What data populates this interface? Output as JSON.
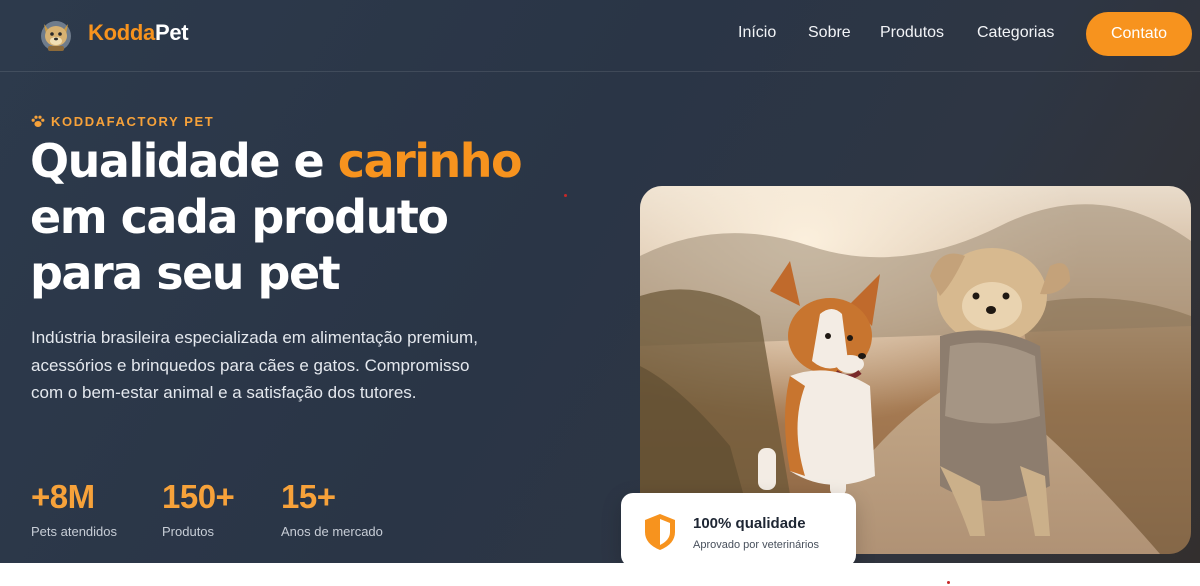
{
  "header": {
    "brand_part1": "Kodda",
    "brand_part2": "Pet",
    "logo_icon": "dog-mascot-logo",
    "nav": [
      "Início",
      "Sobre",
      "Produtos",
      "Categorias"
    ],
    "cta_label": "Contato"
  },
  "hero": {
    "eyebrow_icon": "paw-icon",
    "eyebrow": "KODDAFACTORY PET",
    "headline_before": "Qualidade e ",
    "headline_highlight": "carinho",
    "headline_line2": "em cada produto",
    "headline_line3": "para seu pet",
    "lead": "Indústria brasileira especializada em alimentação premium, acessórios e brinquedos para cães e gatos. Compromisso com o bem-estar animal e a satisfação dos tutores.",
    "stats": [
      {
        "value": "+8M",
        "label": "Pets atendidos"
      },
      {
        "value": "150+",
        "label": "Produtos"
      },
      {
        "value": "15+",
        "label": "Anos de mercado"
      }
    ],
    "image_subject": "corgi-and-yorkshire-dogs-running-on-dirt-path",
    "badge": {
      "icon": "shield-icon",
      "title": "100% qualidade",
      "subtitle": "Aprovado por veterinários"
    }
  },
  "colors": {
    "accent": "#f7931e",
    "hero_background": "#2d3a4c",
    "text_light": "#ffffff"
  }
}
